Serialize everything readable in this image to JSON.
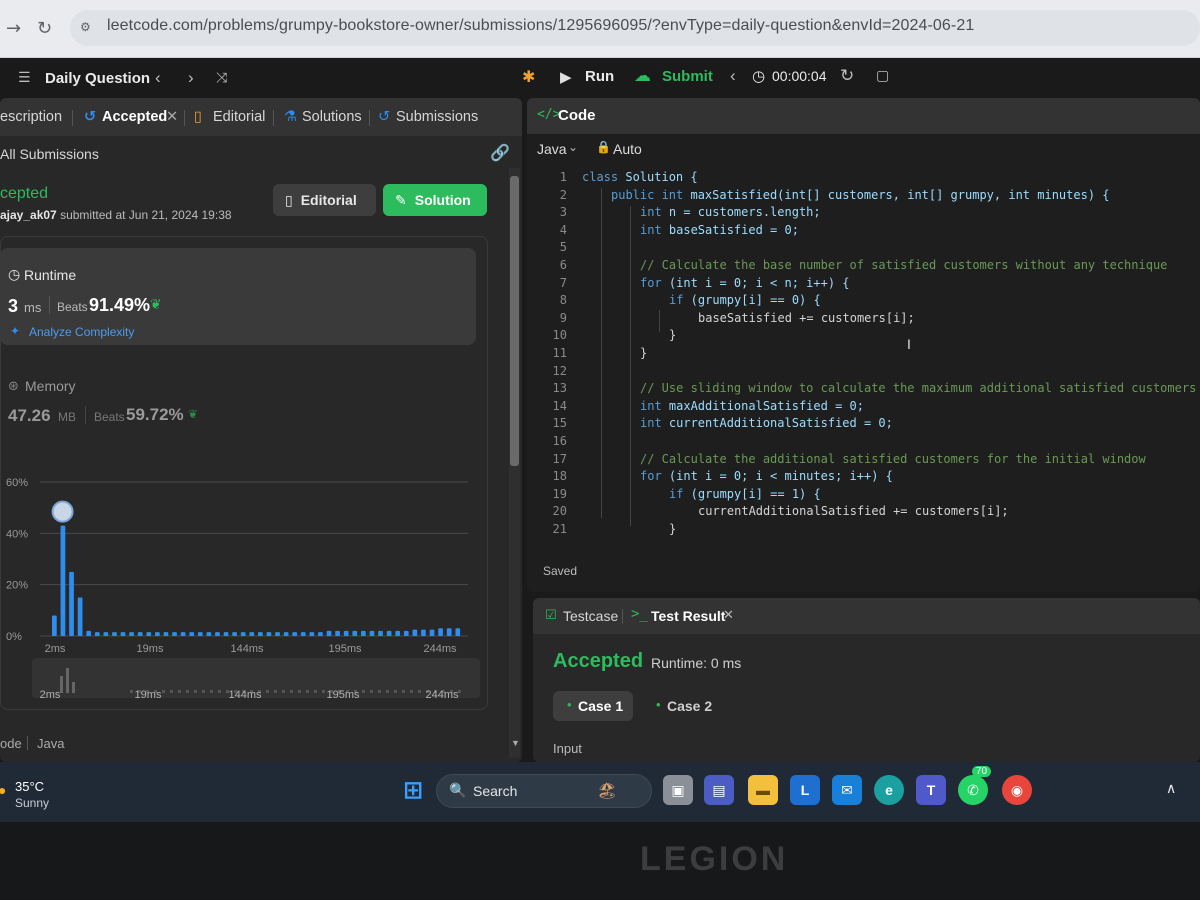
{
  "browser": {
    "url": "leetcode.com/problems/grumpy-bookstore-owner/submissions/1295696095/?envType=daily-question&envId=2024-06-21"
  },
  "topbar": {
    "title": "Daily Question",
    "run_label": "Run",
    "submit_label": "Submit",
    "timer": "00:00:04"
  },
  "left_tabs": [
    {
      "label": "escription"
    },
    {
      "label": "Accepted"
    },
    {
      "label": "Editorial"
    },
    {
      "label": "Solutions"
    },
    {
      "label": "Submissions"
    }
  ],
  "submission": {
    "all_submissions_label": "All Submissions",
    "status": "cepted",
    "user": "ajay_ak07",
    "submitted_text": "submitted at Jun 21, 2024 19:38",
    "editorial_button": "Editorial",
    "solution_button": "Solution"
  },
  "runtime": {
    "label": "Runtime",
    "value": "3",
    "unit": "ms",
    "beats_label": "Beats",
    "beats_value": "91.49%",
    "analyze_label": "Analyze Complexity"
  },
  "memory": {
    "label": "Memory",
    "value": "47.26",
    "unit": "MB",
    "beats_label": "Beats",
    "beats_value": "59.72%"
  },
  "chart_data": {
    "type": "bar",
    "y_ticks": [
      "60%",
      "40%",
      "20%",
      "0%"
    ],
    "x_ticks": [
      "2ms",
      "19ms",
      "144ms",
      "195ms",
      "244ms"
    ],
    "ylim": [
      0,
      60
    ],
    "values": [
      8,
      43,
      25,
      15,
      2,
      1.5,
      1.5,
      1.5,
      1.5,
      1.5,
      1.5,
      1.5,
      1.5,
      1.5,
      1.5,
      1.5,
      1.5,
      1.5,
      1.5,
      1.5,
      1.5,
      1.5,
      1.5,
      1.5,
      1.5,
      1.5,
      1.5,
      1.5,
      1.5,
      1.5,
      1.5,
      1.5,
      2,
      2,
      2,
      2,
      2,
      2,
      2,
      2,
      2,
      2,
      2.5,
      2.5,
      2.5,
      3,
      3,
      3
    ],
    "highlight_index": 1,
    "colors": {
      "bar": "#2d8ef0",
      "grid": "#4a4a4a"
    }
  },
  "mini_ticks": [
    "2ms",
    "19ms",
    "144ms",
    "195ms",
    "244ms"
  ],
  "bottom_left": {
    "code_label": "ode",
    "lang": "Java"
  },
  "code": {
    "title": "Code",
    "language": "Java",
    "mode": "Auto",
    "saved": "Saved",
    "lines": [
      {
        "n": "1",
        "text": "class Solution {",
        "indent": 0
      },
      {
        "n": "2",
        "text": "public int maxSatisfied(int[] customers, int[] grumpy, int minutes) {",
        "indent": 1
      },
      {
        "n": "3",
        "text": "int n = customers.length;",
        "indent": 2
      },
      {
        "n": "4",
        "text": "int baseSatisfied = 0;",
        "indent": 2
      },
      {
        "n": "5",
        "text": "",
        "indent": 2
      },
      {
        "n": "6",
        "text": "// Calculate the base number of satisfied customers without any technique",
        "indent": 2,
        "comment": true
      },
      {
        "n": "7",
        "text": "for (int i = 0; i < n; i++) {",
        "indent": 2
      },
      {
        "n": "8",
        "text": "if (grumpy[i] == 0) {",
        "indent": 3
      },
      {
        "n": "9",
        "text": "baseSatisfied += customers[i];",
        "indent": 4
      },
      {
        "n": "10",
        "text": "}",
        "indent": 3
      },
      {
        "n": "11",
        "text": "}",
        "indent": 2
      },
      {
        "n": "12",
        "text": "",
        "indent": 2
      },
      {
        "n": "13",
        "text": "// Use sliding window to calculate the maximum additional satisfied customers",
        "indent": 2,
        "comment": true
      },
      {
        "n": "14",
        "text": "int maxAdditionalSatisfied = 0;",
        "indent": 2
      },
      {
        "n": "15",
        "text": "int currentAdditionalSatisfied = 0;",
        "indent": 2
      },
      {
        "n": "16",
        "text": "",
        "indent": 2
      },
      {
        "n": "17",
        "text": "// Calculate the additional satisfied customers for the initial window",
        "indent": 2,
        "comment": true
      },
      {
        "n": "18",
        "text": "for (int i = 0; i < minutes; i++) {",
        "indent": 2
      },
      {
        "n": "19",
        "text": "if (grumpy[i] == 1) {",
        "indent": 3
      },
      {
        "n": "20",
        "text": "currentAdditionalSatisfied += customers[i];",
        "indent": 4
      },
      {
        "n": "21",
        "text": "}",
        "indent": 3
      }
    ]
  },
  "test": {
    "testcase_tab": "Testcase",
    "result_tab": "Test Result",
    "status": "Accepted",
    "runtime_text": "Runtime: 0 ms",
    "case1": "Case 1",
    "case2": "Case 2",
    "input_label": "Input"
  },
  "taskbar": {
    "weather_temp": "35°C",
    "weather_desc": "Sunny",
    "search_label": "Search",
    "whatsapp_badge": "70"
  },
  "bezel": {
    "brand": "LEGION"
  }
}
